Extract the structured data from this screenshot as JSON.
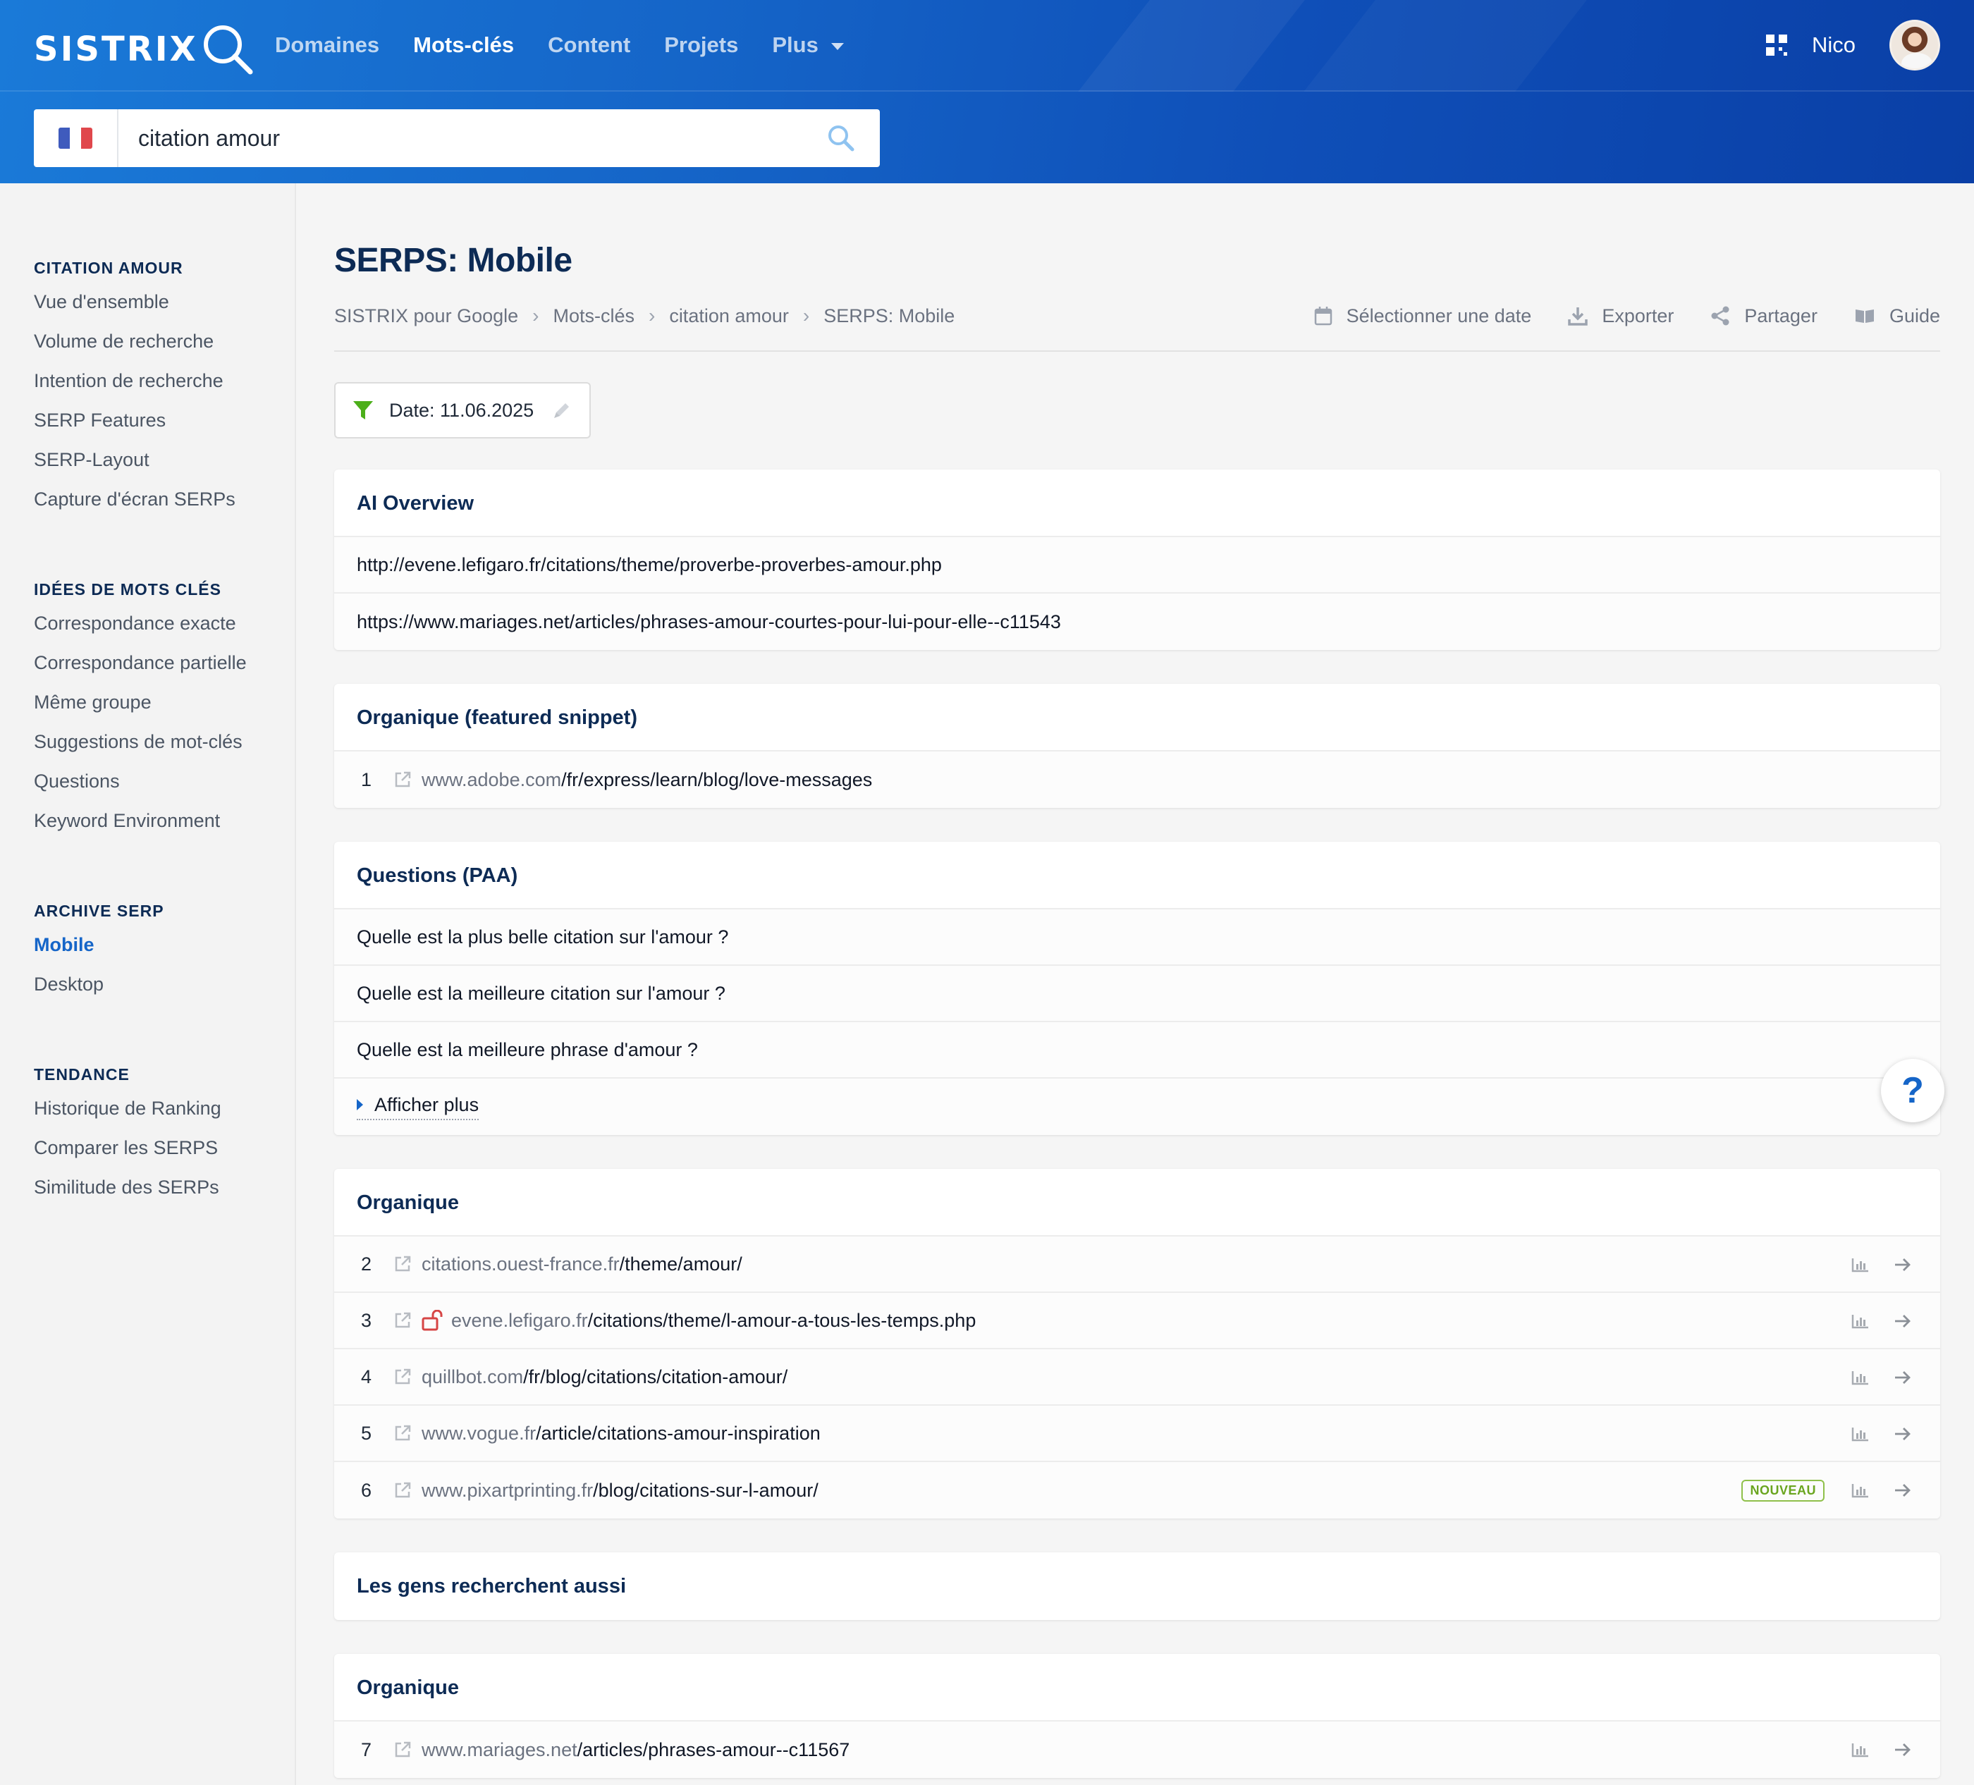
{
  "header": {
    "logo_text": "SISTRIX",
    "nav": [
      {
        "label": "Domaines",
        "active": false
      },
      {
        "label": "Mots-clés",
        "active": true
      },
      {
        "label": "Content",
        "active": false
      },
      {
        "label": "Projets",
        "active": false
      },
      {
        "label": "Plus",
        "active": false,
        "dropdown": true
      }
    ],
    "user_name": "Nico",
    "search_value": "citation amour",
    "country_flag": "france-flag"
  },
  "sidebar": {
    "groups": [
      {
        "heading": "CITATION AMOUR",
        "items": [
          "Vue d'ensemble",
          "Volume de recherche",
          "Intention de recherche",
          "SERP Features",
          "SERP-Layout",
          "Capture d'écran SERPs"
        ]
      },
      {
        "heading": "IDÉES DE MOTS CLÉS",
        "items": [
          "Correspondance exacte",
          "Correspondance partielle",
          "Même groupe",
          "Suggestions de mot-clés",
          "Questions",
          "Keyword Environment"
        ]
      },
      {
        "heading": "ARCHIVE SERP",
        "items": [
          "Mobile",
          "Desktop"
        ],
        "active_item": "Mobile"
      },
      {
        "heading": "TENDANCE",
        "items": [
          "Historique de Ranking",
          "Comparer les SERPS",
          "Similitude des SERPs"
        ]
      }
    ]
  },
  "page": {
    "title": "SERPS: Mobile",
    "breadcrumb": [
      "SISTRIX pour Google",
      "Mots-clés",
      "citation amour",
      "SERPS: Mobile"
    ],
    "actions": {
      "select_date": "Sélectionner une date",
      "export": "Exporter",
      "share": "Partager",
      "guide": "Guide"
    },
    "date_filter": "Date: 11.06.2025"
  },
  "sections": {
    "ai_overview": {
      "title": "AI Overview",
      "urls": [
        "http://evene.lefigaro.fr/citations/theme/proverbe-proverbes-amour.php",
        "https://www.mariages.net/articles/phrases-amour-courtes-pour-lui-pour-elle--c11543"
      ]
    },
    "featured": {
      "title": "Organique (featured snippet)",
      "rows": [
        {
          "pos": "1",
          "domain": "www.adobe.com",
          "path": "/fr/express/learn/blog/love-messages"
        }
      ]
    },
    "paa": {
      "title": "Questions (PAA)",
      "questions": [
        "Quelle est la plus belle citation sur l'amour ?",
        "Quelle est la meilleure citation sur l'amour ?",
        "Quelle est la meilleure phrase d'amour ?"
      ],
      "show_more": "Afficher plus"
    },
    "organic": {
      "title": "Organique",
      "rows": [
        {
          "pos": "2",
          "domain": "citations.ouest-france.fr",
          "path": "/theme/amour/"
        },
        {
          "pos": "3",
          "domain": "evene.lefigaro.fr",
          "path": "/citations/theme/l-amour-a-tous-les-temps.php",
          "unlocked": true
        },
        {
          "pos": "4",
          "domain": "quillbot.com",
          "path": "/fr/blog/citations/citation-amour/"
        },
        {
          "pos": "5",
          "domain": "www.vogue.fr",
          "path": "/article/citations-amour-inspiration"
        },
        {
          "pos": "6",
          "domain": "www.pixartprinting.fr",
          "path": "/blog/citations-sur-l-amour/",
          "badge": "NOUVEAU"
        }
      ]
    },
    "people_also": {
      "title": "Les gens recherchent aussi"
    },
    "organic2": {
      "title": "Organique",
      "rows": [
        {
          "pos": "7",
          "domain": "www.mariages.net",
          "path": "/articles/phrases-amour--c11567"
        }
      ]
    }
  },
  "help_label": "?",
  "colors": {
    "brand_blue": "#1565c8",
    "heading_navy": "#0d2b55",
    "new_badge_green": "#6aa51f",
    "lock_red": "#d64545"
  }
}
